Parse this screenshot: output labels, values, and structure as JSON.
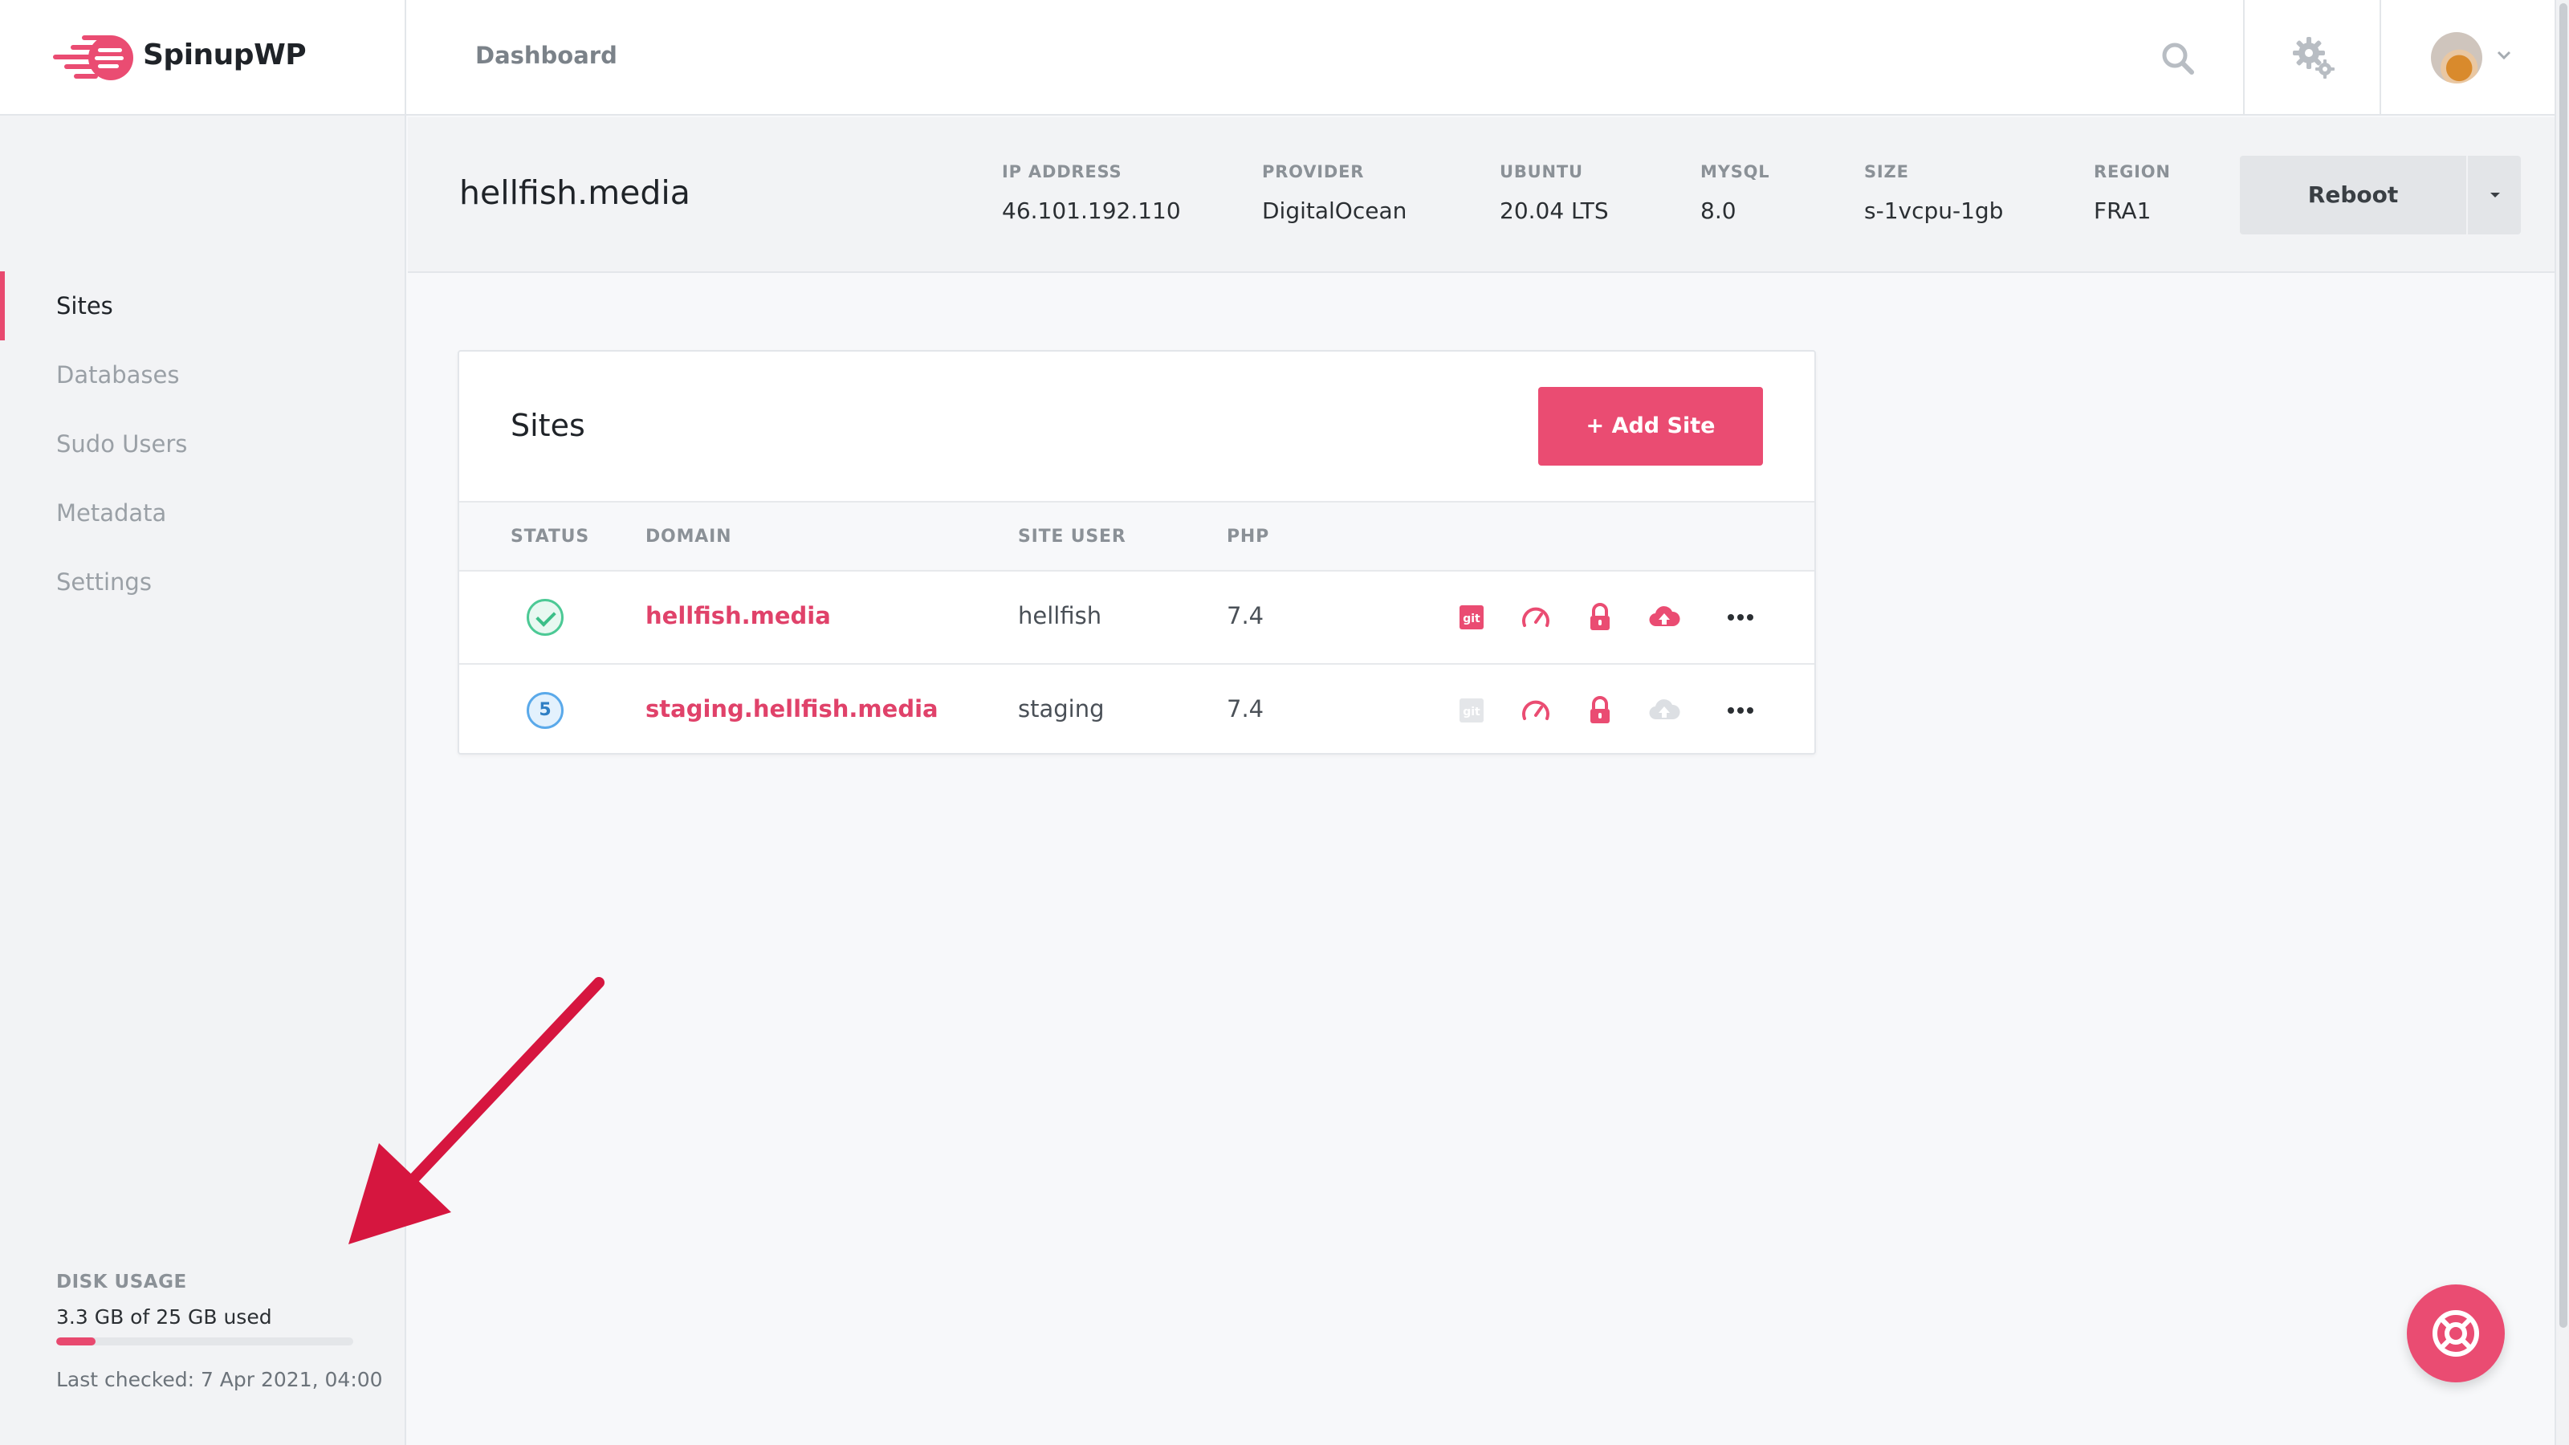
{
  "app": {
    "name": "SpinupWP",
    "breadcrumb": "Dashboard",
    "accent": "#e8496f"
  },
  "header_icons": [
    "search-icon",
    "gear-icon",
    "avatar",
    "chevron-down-icon"
  ],
  "sidebar": {
    "items": [
      {
        "label": "Sites",
        "active": true
      },
      {
        "label": "Databases",
        "active": false
      },
      {
        "label": "Sudo Users",
        "active": false
      },
      {
        "label": "Metadata",
        "active": false
      },
      {
        "label": "Settings",
        "active": false
      }
    ],
    "disk": {
      "title": "DISK USAGE",
      "used_text": "3.3 GB of 25 GB used",
      "used_fraction": 0.132,
      "last_checked": "Last checked: 7 Apr 2021, 04:00"
    }
  },
  "server": {
    "name": "hellfish.media",
    "meta": [
      {
        "label": "IP ADDRESS",
        "value": "46.101.192.110"
      },
      {
        "label": "PROVIDER",
        "value": "DigitalOcean"
      },
      {
        "label": "UBUNTU",
        "value": "20.04 LTS"
      },
      {
        "label": "MYSQL",
        "value": "8.0"
      },
      {
        "label": "SIZE",
        "value": "s-1vcpu-1gb"
      },
      {
        "label": "REGION",
        "value": "FRA1"
      }
    ],
    "reboot_label": "Reboot"
  },
  "sites": {
    "title": "Sites",
    "add_label": "+ Add Site",
    "columns": [
      "STATUS",
      "DOMAIN",
      "SITE USER",
      "PHP"
    ],
    "rows": [
      {
        "status": "ok",
        "domain": "hellfish.media",
        "site_user": "hellfish",
        "php": "7.4",
        "git_enabled": true,
        "backup_enabled": true
      },
      {
        "status": "5",
        "domain": "staging.hellfish.media",
        "site_user": "staging",
        "php": "7.4",
        "git_enabled": false,
        "backup_enabled": false
      }
    ],
    "row_icons": [
      "git-icon",
      "speedometer-icon",
      "lock-icon",
      "cloud-upload-icon",
      "more-icon"
    ]
  },
  "colors": {
    "brand": "#ea4c72",
    "success": "#3cbf88",
    "info": "#5aa9ea",
    "arrow": "#d6163f"
  }
}
